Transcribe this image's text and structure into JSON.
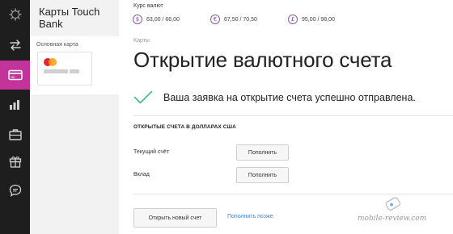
{
  "sidebar": {
    "items": [
      {
        "icon": "settings-gear-icon",
        "active": false
      },
      {
        "icon": "transfer-arrows-icon",
        "active": false
      },
      {
        "icon": "card-icon",
        "active": true
      },
      {
        "icon": "bar-chart-icon",
        "active": false
      },
      {
        "icon": "briefcase-icon",
        "active": false
      },
      {
        "icon": "gift-icon",
        "active": false
      },
      {
        "icon": "chat-icon",
        "active": false
      }
    ],
    "active_color": "#c2349b"
  },
  "card_panel": {
    "bank_title": "Карты Touch Bank",
    "card_label": "Основная карта",
    "card_brand_icon": "mastercard-icon"
  },
  "rates": {
    "title": "Курс валют",
    "items": [
      {
        "symbol": "$",
        "value": "63,00 / 66,00"
      },
      {
        "symbol": "€",
        "value": "67,50 / 70,50"
      },
      {
        "symbol": "£",
        "value": "95,00 / 98,00"
      }
    ]
  },
  "main": {
    "breadcrumb": "Карты",
    "title": "Открытие валютного счета",
    "success_message": "Ваша заявка на открытие счета успешно отправлена.",
    "success_color": "#3fb59a",
    "section_title": "ОТКРЫТЫЕ СЧЕТА В ДОЛЛАРАХ США",
    "accounts": [
      {
        "label": "Текущий счёт",
        "button": "Пополнить"
      },
      {
        "label": "Вклад",
        "button": "Пополнить"
      }
    ],
    "open_new_button": "Открыть новый счет",
    "later_link": "Пополнить позже"
  },
  "watermark": "mobile-review.com"
}
